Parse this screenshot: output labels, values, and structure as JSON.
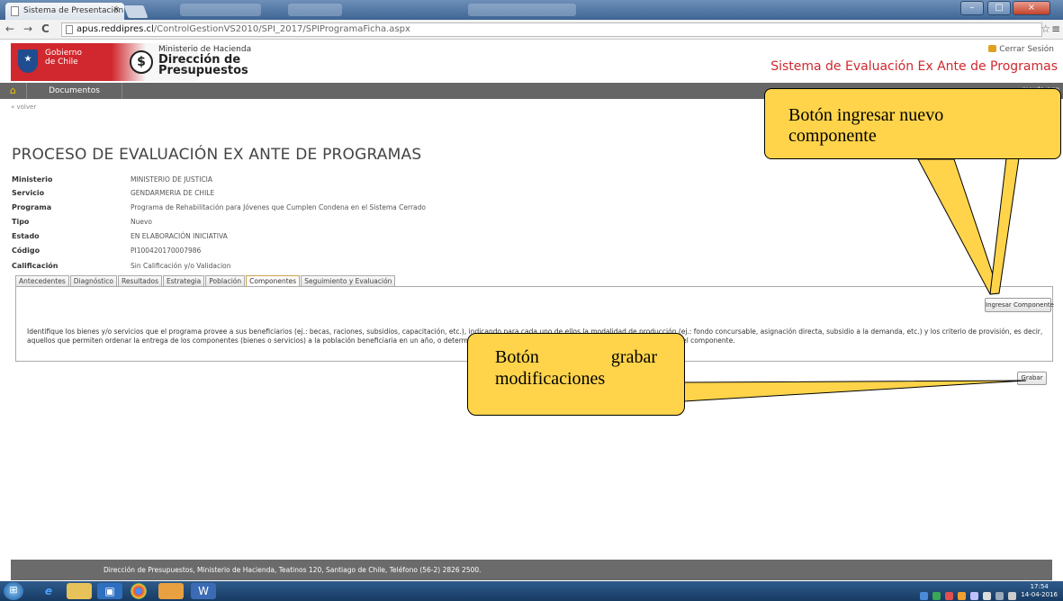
{
  "browser": {
    "tab_title": "Sistema de Presentación",
    "tab_close": "×",
    "url_host": "apus.reddipres.cl",
    "url_path": "/ControlGestionVS2010/SPI_2017/SPIProgramaFicha.aspx",
    "back": "←",
    "forward": "→",
    "reload": "C",
    "star": "☆",
    "menu": "≡"
  },
  "header": {
    "gob_line1": "Gobierno",
    "gob_line2": "de Chile",
    "dipres_line1": "Ministerio de Hacienda",
    "dipres_line2": "Dirección de",
    "dipres_line3": "Presupuestos",
    "dipres_symbol": "$",
    "cerrar_sesion": "Cerrar Sesión",
    "sistema": "Sistema de Evaluación Ex Ante de Programas"
  },
  "nav": {
    "documentos": "Documentos",
    "right": "ayuda.asp",
    "home_symbol": "⌂"
  },
  "volver": "« volver",
  "page_title": "PROCESO DE EVALUACIÓN EX ANTE DE PROGRAMAS",
  "info": [
    {
      "label": "Ministerio",
      "value": "MINISTERIO DE JUSTICIA"
    },
    {
      "label": "Servicio",
      "value": "GENDARMERIA DE CHILE"
    },
    {
      "label": "Programa",
      "value": "Programa de Rehabilitación para Jóvenes que Cumplen Condena en el Sistema Cerrado"
    },
    {
      "label": "Tipo",
      "value": "Nuevo"
    },
    {
      "label": "Estado",
      "value": "EN ELABORACIÓN INICIATIVA"
    },
    {
      "label": "Código",
      "value": "PI100420170007986"
    },
    {
      "label": "Calificación",
      "value": "Sin Calificación y/o Validacion"
    }
  ],
  "tabs": [
    "Antecedentes",
    "Diagnóstico",
    "Resultados",
    "Estrategia",
    "Población",
    "Componentes",
    "Seguimiento y Evaluación"
  ],
  "active_tab": "Componentes",
  "panel": {
    "ingresar_button": "Ingresar Componente",
    "description": "Identifique los bienes y/o servicios que el programa provee a sus beneficiarios (ej.: becas, raciones, subsidios, capacitación, etc.), indicando para cada uno de ellos la modalidad de producción (ej.: fondo concursable, asignación directa, subsidio a la demanda, etc.) y los criterio de provisión, es decir, aquellos que permiten ordenar la entrega de los componentes (bienes o servicios) a la población beneficiaria en un año, o determinar qué beneficiarios dentro de la población objetivo recibirán el componente."
  },
  "grabar_button": "Grabar",
  "footer": "Dirección de Presupuestos, Ministerio de Hacienda, Teatinos 120, Santiago de Chile, Teléfono (56-2) 2826 2500.",
  "callouts": {
    "nuevo_line1": "Botón ingresar nuevo",
    "nuevo_line2": "componente",
    "grabar_line1_a": "Botón",
    "grabar_line1_b": "grabar",
    "grabar_line2": "modificaciones"
  },
  "taskbar": {
    "time": "17:54",
    "date": "14-04-2016"
  },
  "colors": {
    "gob_red": "#d0282e",
    "navbar_gray": "#666666",
    "callout_yellow": "#ffd44a",
    "taskbar_blue": "#1f4a78"
  }
}
